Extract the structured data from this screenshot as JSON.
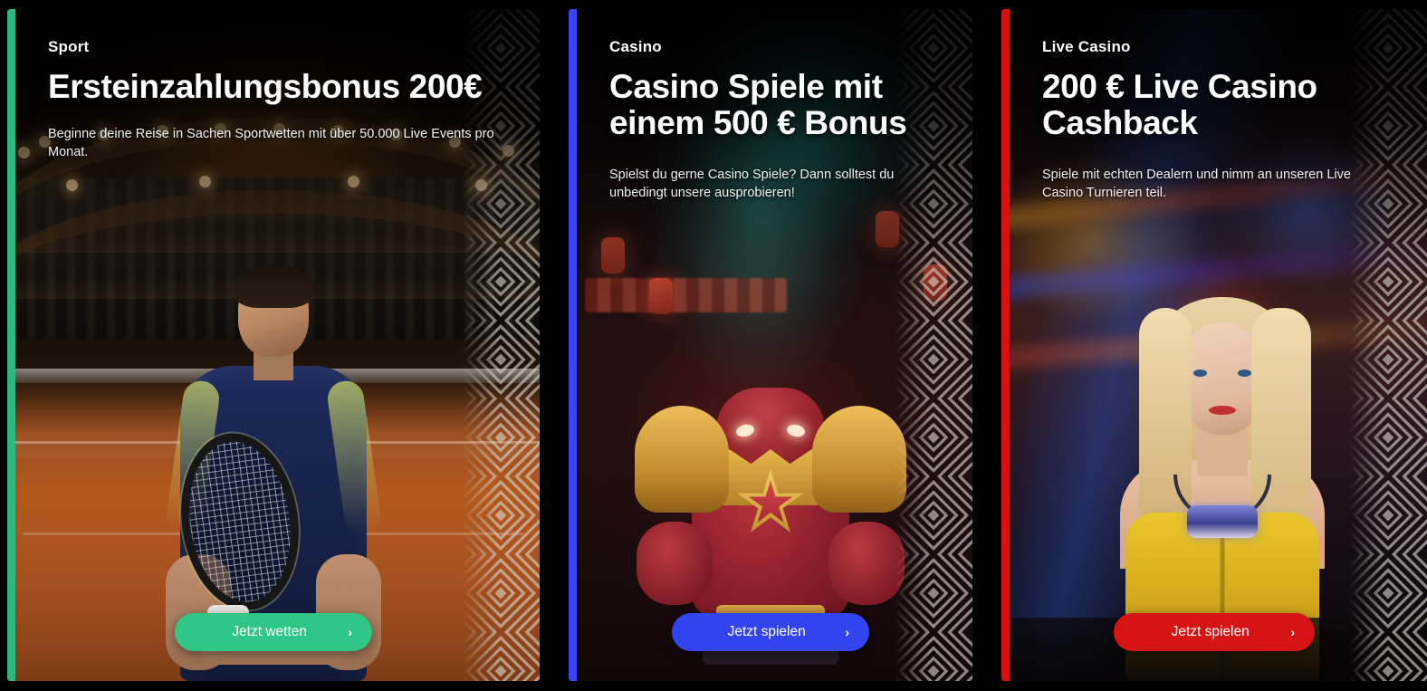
{
  "page": {
    "background_color": "#000000",
    "layout": "three-promo-cards-row"
  },
  "cards": [
    {
      "id": "sport",
      "category": "Sport",
      "title": "Ersteinzahlungsbonus 200€",
      "description": "Beginne deine Reise in Sachen Sportwetten mit über 50.000 Live Events pro Monat.",
      "cta_label": "Jetzt wetten",
      "cta_chevron": "›",
      "accent_color": "#2fb782",
      "button_color": "#30c685",
      "artwork_alt": "tennis-player-on-clay-court"
    },
    {
      "id": "casino",
      "category": "Casino",
      "title": "Casino Spiele mit einem 500 € Bonus",
      "description": "Spielst du gerne Casino Spiele? Dann solltest du unbedingt unsere ausprobieren!",
      "cta_label": "Jetzt spielen",
      "cta_chevron": "›",
      "accent_color": "#3b44f5",
      "button_color": "#3443f0",
      "artwork_alt": "red-armored-warrior-character"
    },
    {
      "id": "live-casino",
      "category": "Live Casino",
      "title": "200 € Live Casino Cashback",
      "description": "Spiele mit echten Dealern und nimm an unseren Live Casino Turnieren teil.",
      "cta_label": "Jetzt spielen",
      "cta_chevron": "›",
      "accent_color": "#d61111",
      "button_color": "#d71414",
      "artwork_alt": "live-casino-dealer-woman"
    }
  ],
  "decor": {
    "pattern_name": "greek-key-diamond-pattern",
    "pattern_color": "#d8d4cc"
  }
}
